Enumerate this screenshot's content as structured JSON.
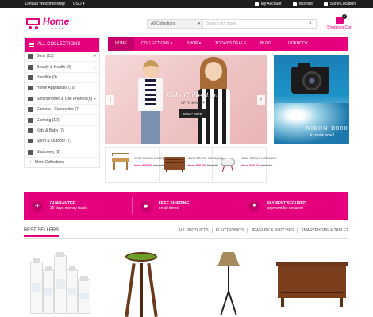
{
  "topbar": {
    "welcome": "Default Welcome Msg!",
    "currency": "USD ▾",
    "links": [
      "My Account",
      "Wishlist",
      "Store Location"
    ]
  },
  "header": {
    "logo_name": "Home",
    "logo_sub": "market",
    "search_category": "All Collections",
    "search_placeholder": "Search our store",
    "cart_label": "Shopping Cart",
    "cart_count": "0"
  },
  "nav": [
    "HOME",
    "COLLECTIONS ▾",
    "SHOP ▾",
    "TODAY'S DEALS",
    "BLOG",
    "LOOKBOOK"
  ],
  "sidebar": {
    "title": "ALL COLLECTIONS",
    "items": [
      {
        "label": "Book (13)",
        "arrow": true
      },
      {
        "label": "Beauty & Health (9)",
        "arrow": true
      },
      {
        "label": "Handlife (9)",
        "arrow": false
      },
      {
        "label": "Home Appliances (10)",
        "arrow": false
      },
      {
        "label": "Smartphones & Cell Phones (6)",
        "arrow": true
      },
      {
        "label": "Camera - Camcorder (7)",
        "arrow": false
      },
      {
        "label": "Clothing (10)",
        "arrow": false
      },
      {
        "label": "Kids & Baby (7)",
        "arrow": false
      },
      {
        "label": "Sport & Outdoor (7)",
        "arrow": false
      },
      {
        "label": "Stationery (8)",
        "arrow": false
      }
    ],
    "more": "More Collections"
  },
  "slider": {
    "title": "Kids Collection",
    "subtitle": "UP TO 40% OFF",
    "button": "SHOP NOW"
  },
  "promo": {
    "name": "NIKON D800",
    "stock": "in stock now !"
  },
  "products": [
    {
      "title": "CUM SOCIIS NATOQUE",
      "price": "from $80.00",
      "old": "$110.00"
    },
    {
      "title": "CUM SOCIIS NATOQUE",
      "price": "from $80.00",
      "old": "$110.00"
    },
    {
      "title": "CUM SOCIIS NATOQUE",
      "price": "from $80.00",
      "old": "$110.00"
    }
  ],
  "features": [
    {
      "icon": "plane-icon",
      "title": "GUARANTEE",
      "text": "30 days money back!"
    },
    {
      "icon": "truck-icon",
      "title": "FREE SHIPPING",
      "text": "on all items"
    },
    {
      "icon": "lock-icon",
      "title": "PAYMENT SECURED",
      "text": "payment be secured"
    }
  ],
  "best_sellers": {
    "title": "BEST SELLERS",
    "tabs": [
      "ALL PRODUCTS",
      "ELECTRONICS",
      "JEWELRY & WATCHES",
      "SMARTPHONE & TABLET"
    ]
  },
  "colors": {
    "brand": "#e5007e",
    "dark": "#1e1e1e"
  }
}
